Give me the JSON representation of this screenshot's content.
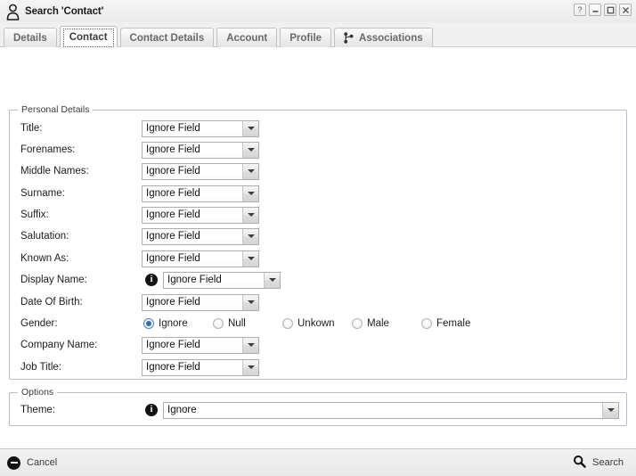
{
  "window": {
    "title": "Search 'Contact'",
    "title_icon": "person-icon",
    "controls": [
      {
        "name": "help-button",
        "glyph": "?"
      },
      {
        "name": "minimize-button",
        "glyph": "minimize-icon"
      },
      {
        "name": "maximize-button",
        "glyph": "maximize-icon"
      },
      {
        "name": "close-button",
        "glyph": "close-icon"
      }
    ]
  },
  "tabs": [
    {
      "label": "Details",
      "active": false,
      "icon": null
    },
    {
      "label": "Contact",
      "active": true,
      "icon": null
    },
    {
      "label": "Contact Details",
      "active": false,
      "icon": null
    },
    {
      "label": "Account",
      "active": false,
      "icon": null
    },
    {
      "label": "Profile",
      "active": false,
      "icon": null
    },
    {
      "label": "Associations",
      "active": false,
      "icon": "branch-icon"
    }
  ],
  "personal_details": {
    "legend": "Personal Details",
    "fields": [
      {
        "label": "Title:",
        "value": "Ignore Field",
        "info": false
      },
      {
        "label": "Forenames:",
        "value": "Ignore Field",
        "info": false
      },
      {
        "label": "Middle Names:",
        "value": "Ignore Field",
        "info": false
      },
      {
        "label": "Surname:",
        "value": "Ignore Field",
        "info": false
      },
      {
        "label": "Suffix:",
        "value": "Ignore Field",
        "info": false
      },
      {
        "label": "Salutation:",
        "value": "Ignore Field",
        "info": false
      },
      {
        "label": "Known As:",
        "value": "Ignore Field",
        "info": false
      },
      {
        "label": "Display Name:",
        "value": "Ignore Field",
        "info": true
      },
      {
        "label": "Date Of Birth:",
        "value": "Ignore Field",
        "info": false
      }
    ],
    "gender": {
      "label": "Gender:",
      "options": [
        {
          "label": "Ignore",
          "checked": true
        },
        {
          "label": "Null",
          "checked": false
        },
        {
          "label": "Unkown",
          "checked": false
        },
        {
          "label": "Male",
          "checked": false
        },
        {
          "label": "Female",
          "checked": false
        }
      ]
    },
    "fields_after_gender": [
      {
        "label": "Company Name:",
        "value": "Ignore Field",
        "info": false
      },
      {
        "label": "Job Title:",
        "value": "Ignore Field",
        "info": false
      }
    ]
  },
  "options": {
    "legend": "Options",
    "theme": {
      "label": "Theme:",
      "value": "Ignore",
      "info": true
    }
  },
  "footer": {
    "cancel_label": "Cancel",
    "cancel_icon": "cancel-icon",
    "search_label": "Search",
    "search_icon": "magnifier-icon"
  },
  "colors": {
    "accent": "#2f6fb5",
    "panel_border": "#b9bcd0",
    "window_bg": "#f0f0f0",
    "content_bg": "#ffffff"
  }
}
